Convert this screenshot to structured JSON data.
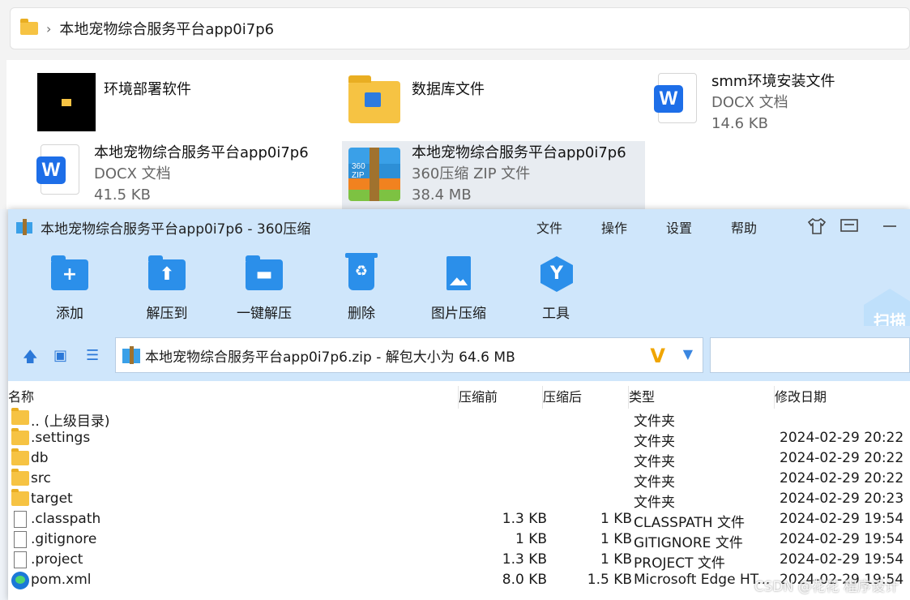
{
  "explorer": {
    "breadcrumb_sep": "›",
    "path": "本地宠物综合服务平台app0i7p6",
    "items": [
      {
        "name": "环境部署软件",
        "line2": "",
        "line3": ""
      },
      {
        "name": "数据库文件",
        "line2": "",
        "line3": ""
      },
      {
        "name": "smm环境安装文件",
        "line2": "DOCX 文档",
        "line3": "14.6 KB"
      },
      {
        "name": "本地宠物综合服务平台app0i7p6",
        "line2": "DOCX 文档",
        "line3": "41.5 KB"
      },
      {
        "name": "本地宠物综合服务平台app0i7p6",
        "line2": "360压缩 ZIP 文件",
        "line3": "38.4 MB"
      }
    ]
  },
  "window": {
    "title": "本地宠物综合服务平台app0i7p6 - 360压缩",
    "menus": [
      "文件",
      "操作",
      "设置",
      "帮助"
    ],
    "icons": [
      "shirt-icon",
      "message-icon",
      "minimize-icon"
    ],
    "toolbar": [
      {
        "label": "添加",
        "icon": "add-folder-icon",
        "glyph": "+"
      },
      {
        "label": "解压到",
        "icon": "extract-to-icon",
        "glyph": "⬆"
      },
      {
        "label": "一键解压",
        "icon": "one-click-extract-icon",
        "glyph": "▬"
      },
      {
        "label": "删除",
        "icon": "delete-icon",
        "glyph": "♻"
      },
      {
        "label": "图片压缩",
        "icon": "image-compress-icon",
        "glyph": ""
      },
      {
        "label": "工具",
        "icon": "tools-icon",
        "glyph": "Y"
      }
    ],
    "scan_label": "扫描",
    "nav_glyphs": {
      "up": "🡅",
      "thumb": "▣",
      "list": "☰"
    },
    "pathbar": {
      "text": "本地宠物综合服务平台app0i7p6.zip - 解包大小为 64.6 MB",
      "v_glyph": "V",
      "dropdown_glyph": "▼"
    },
    "columns": [
      "名称",
      "压缩前",
      "压缩后",
      "类型",
      "修改日期"
    ],
    "rows": [
      {
        "icon": "folder",
        "name": ".. (上级目录)",
        "before": "",
        "after": "",
        "type": "文件夹",
        "date": ""
      },
      {
        "icon": "folder",
        "name": ".settings",
        "before": "",
        "after": "",
        "type": "文件夹",
        "date": "2024-02-29 20:22"
      },
      {
        "icon": "folder",
        "name": "db",
        "before": "",
        "after": "",
        "type": "文件夹",
        "date": "2024-02-29 20:22"
      },
      {
        "icon": "folder",
        "name": "src",
        "before": "",
        "after": "",
        "type": "文件夹",
        "date": "2024-02-29 20:22"
      },
      {
        "icon": "folder",
        "name": "target",
        "before": "",
        "after": "",
        "type": "文件夹",
        "date": "2024-02-29 20:23"
      },
      {
        "icon": "file",
        "name": ".classpath",
        "before": "1.3 KB",
        "after": "1 KB",
        "type": "CLASSPATH 文件",
        "date": "2024-02-29 19:54"
      },
      {
        "icon": "file",
        "name": ".gitignore",
        "before": "1 KB",
        "after": "1 KB",
        "type": "GITIGNORE 文件",
        "date": "2024-02-29 19:54"
      },
      {
        "icon": "file",
        "name": ".project",
        "before": "1.3 KB",
        "after": "1 KB",
        "type": "PROJECT 文件",
        "date": "2024-02-29 19:54"
      },
      {
        "icon": "edge",
        "name": "pom.xml",
        "before": "8.0 KB",
        "after": "1.5 KB",
        "type": "Microsoft Edge HT...",
        "date": "2024-02-29 19:54"
      }
    ]
  },
  "watermark": "CSDN @花花 程序设计"
}
